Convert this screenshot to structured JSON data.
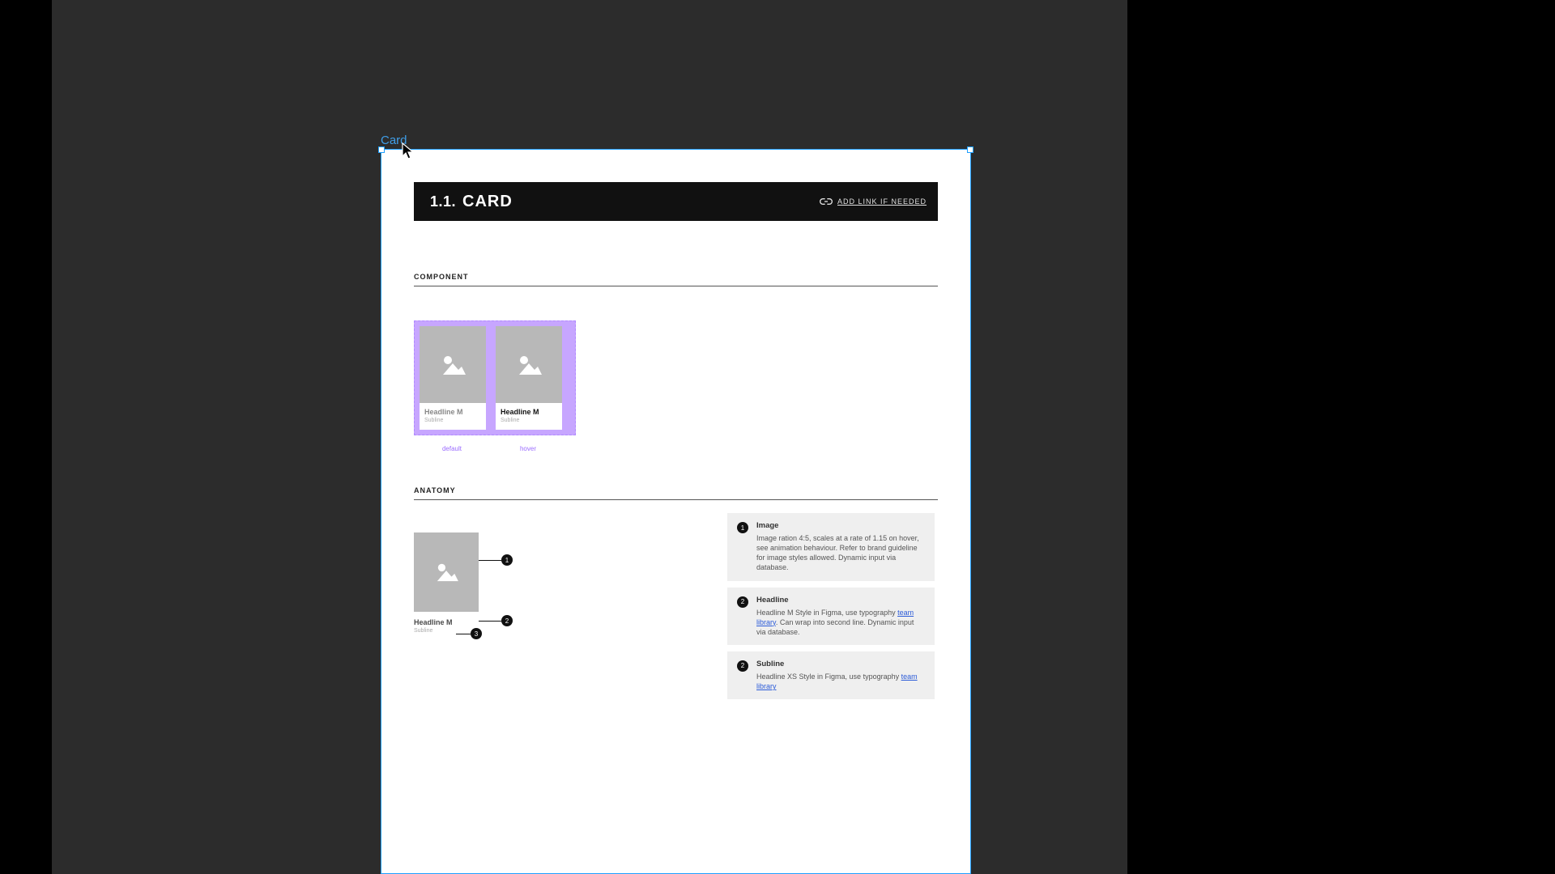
{
  "frame_label": "Card",
  "header": {
    "number": "1.1.",
    "title": "CARD",
    "link_label": "ADD LINK IF NEEDED"
  },
  "sections": {
    "component": "COMPONENT",
    "anatomy": "ANATOMY"
  },
  "variants": {
    "default": {
      "headline": "Headline M",
      "subline": "Subline",
      "label": "default"
    },
    "hover": {
      "headline": "Headline M",
      "subline": "Subline",
      "label": "hover"
    }
  },
  "anatomy_card": {
    "headline": "Headline M",
    "subline": "Subline"
  },
  "callouts": {
    "one": "1",
    "two": "2",
    "three": "3"
  },
  "specs": [
    {
      "num": "1",
      "title": "Image",
      "desc_pre": "Image ration 4:5, scales at a rate of 1.15 on hover, see animation behaviour.\nRefer to brand guideline for image styles allowed.\nDynamic input via database.",
      "link": "",
      "desc_post": ""
    },
    {
      "num": "2",
      "title": "Headline",
      "desc_pre": "Headline M Style in Figma, use typography ",
      "link": "team library",
      "desc_post": ". Can wrap into second line. Dynamic input via database."
    },
    {
      "num": "2",
      "title": "Subline",
      "desc_pre": "Headline XS Style in Figma, use typography ",
      "link": "team library",
      "desc_post": ""
    }
  ]
}
